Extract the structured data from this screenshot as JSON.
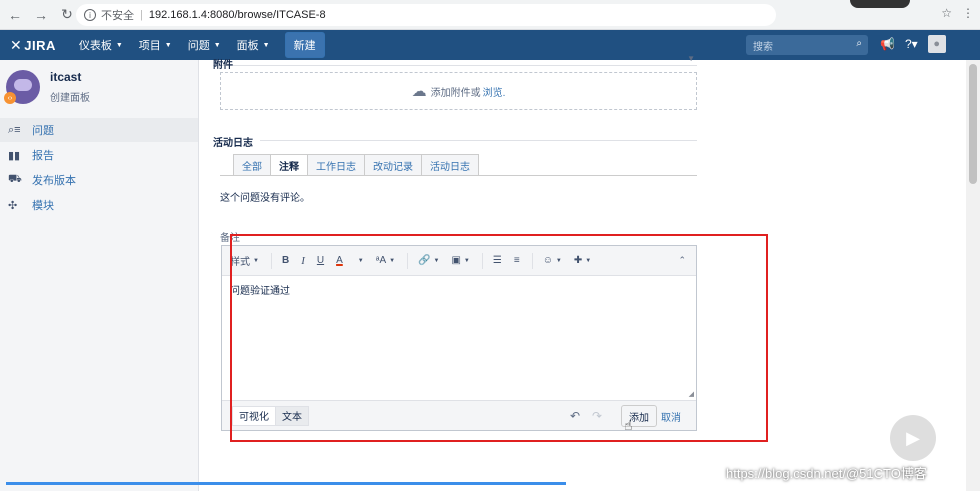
{
  "browser": {
    "security_label": "不安全",
    "url": "192.168.1.4:8080/browse/ITCASE-8"
  },
  "header": {
    "logo": "JIRA",
    "menu": [
      "仪表板",
      "项目",
      "问题",
      "面板"
    ],
    "create_label": "新建",
    "search_placeholder": "搜索"
  },
  "sidebar": {
    "project_name": "itcast",
    "project_sub": "创建面板",
    "items": [
      {
        "label": "问题",
        "icon": "issues-icon"
      },
      {
        "label": "报告",
        "icon": "reports-icon"
      },
      {
        "label": "发布版本",
        "icon": "releases-icon"
      },
      {
        "label": "模块",
        "icon": "components-icon"
      }
    ]
  },
  "main": {
    "attachments_heading": "附件",
    "dropzone_text": "添加附件或",
    "dropzone_browse": "浏览.",
    "activity_heading": "活动日志",
    "tabs": [
      "全部",
      "注释",
      "工作日志",
      "改动记录",
      "活动日志"
    ],
    "active_tab": "注释",
    "no_comments": "这个问题没有评论。",
    "comment_label": "备注",
    "toolbar": {
      "style_label": "样式"
    },
    "comment_text": "问题验证通过",
    "mode_visual": "可视化",
    "mode_text": "文本",
    "add_label": "添加",
    "cancel_label": "取消"
  },
  "overlay": {
    "watermark": "https://blog.csdn.net/@51CTO博客"
  }
}
